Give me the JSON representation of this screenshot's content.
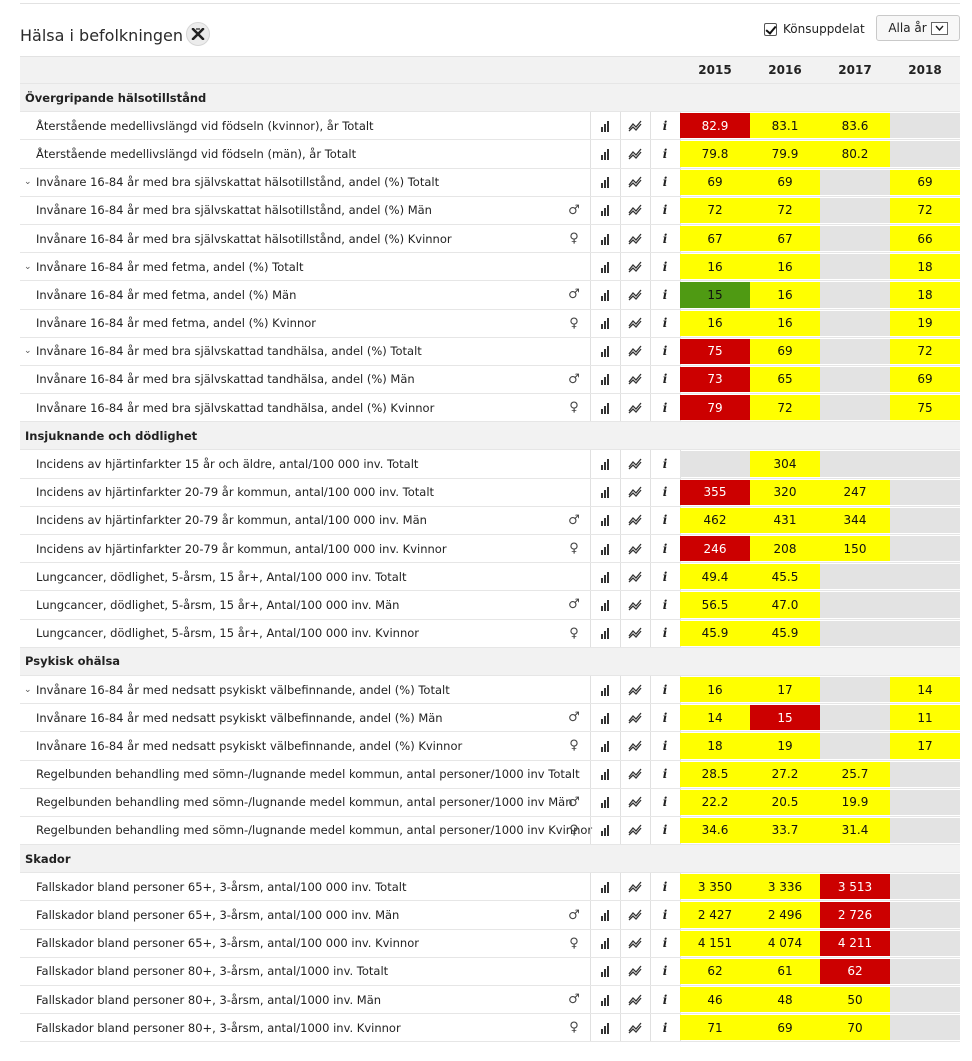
{
  "header": {
    "title": "Hälsa i befolkningen",
    "gender_split_label": "Könsuppdelat",
    "gender_split_checked": true,
    "year_select_label": "Alla år"
  },
  "years": [
    "2015",
    "2016",
    "2017",
    "2018"
  ],
  "colors": {
    "yellow": "#ffff00",
    "red": "#cc0000",
    "green": "#4f9a13",
    "gray": "#e3e3e3"
  },
  "icons": {
    "excel": "excel-icon",
    "bar": "bar-chart-icon",
    "trend": "trend-icon",
    "info": "info-icon",
    "male": "male-icon",
    "female": "female-icon"
  },
  "sections": [
    {
      "title": "Övergripande hälsotillstånd",
      "rows": [
        {
          "label": "Återstående medellivslängd vid födseln (kvinnor), år Totalt",
          "expandable": false,
          "gender": "",
          "cells": [
            {
              "v": "82.9",
              "c": "red"
            },
            {
              "v": "83.1",
              "c": "yellow"
            },
            {
              "v": "83.6",
              "c": "yellow"
            },
            {
              "v": "",
              "c": "gray"
            }
          ]
        },
        {
          "label": "Återstående medellivslängd vid födseln (män), år Totalt",
          "expandable": false,
          "gender": "",
          "cells": [
            {
              "v": "79.8",
              "c": "yellow"
            },
            {
              "v": "79.9",
              "c": "yellow"
            },
            {
              "v": "80.2",
              "c": "yellow"
            },
            {
              "v": "",
              "c": "gray"
            }
          ]
        },
        {
          "label": "Invånare 16-84 år med bra självskattat hälsotillstånd, andel (%) Totalt",
          "expandable": true,
          "gender": "",
          "cells": [
            {
              "v": "69",
              "c": "yellow"
            },
            {
              "v": "69",
              "c": "yellow"
            },
            {
              "v": "",
              "c": "gray"
            },
            {
              "v": "69",
              "c": "yellow"
            }
          ]
        },
        {
          "label": "Invånare 16-84 år med bra självskattat hälsotillstånd, andel (%) Män",
          "expandable": false,
          "gender": "male",
          "cells": [
            {
              "v": "72",
              "c": "yellow"
            },
            {
              "v": "72",
              "c": "yellow"
            },
            {
              "v": "",
              "c": "gray"
            },
            {
              "v": "72",
              "c": "yellow"
            }
          ]
        },
        {
          "label": "Invånare 16-84 år med bra självskattat hälsotillstånd, andel (%) Kvinnor",
          "expandable": false,
          "gender": "female",
          "cells": [
            {
              "v": "67",
              "c": "yellow"
            },
            {
              "v": "67",
              "c": "yellow"
            },
            {
              "v": "",
              "c": "gray"
            },
            {
              "v": "66",
              "c": "yellow"
            }
          ]
        },
        {
          "label": "Invånare 16-84 år med fetma, andel (%) Totalt",
          "expandable": true,
          "gender": "",
          "cells": [
            {
              "v": "16",
              "c": "yellow"
            },
            {
              "v": "16",
              "c": "yellow"
            },
            {
              "v": "",
              "c": "gray"
            },
            {
              "v": "18",
              "c": "yellow"
            }
          ]
        },
        {
          "label": "Invånare 16-84 år med fetma, andel (%) Män",
          "expandable": false,
          "gender": "male",
          "cells": [
            {
              "v": "15",
              "c": "green"
            },
            {
              "v": "16",
              "c": "yellow"
            },
            {
              "v": "",
              "c": "gray"
            },
            {
              "v": "18",
              "c": "yellow"
            }
          ]
        },
        {
          "label": "Invånare 16-84 år med fetma, andel (%) Kvinnor",
          "expandable": false,
          "gender": "female",
          "cells": [
            {
              "v": "16",
              "c": "yellow"
            },
            {
              "v": "16",
              "c": "yellow"
            },
            {
              "v": "",
              "c": "gray"
            },
            {
              "v": "19",
              "c": "yellow"
            }
          ]
        },
        {
          "label": "Invånare 16-84 år med bra självskattad tandhälsa, andel (%) Totalt",
          "expandable": true,
          "gender": "",
          "cells": [
            {
              "v": "75",
              "c": "red"
            },
            {
              "v": "69",
              "c": "yellow"
            },
            {
              "v": "",
              "c": "gray"
            },
            {
              "v": "72",
              "c": "yellow"
            }
          ]
        },
        {
          "label": "Invånare 16-84 år med bra självskattad tandhälsa, andel (%) Män",
          "expandable": false,
          "gender": "male",
          "cells": [
            {
              "v": "73",
              "c": "red"
            },
            {
              "v": "65",
              "c": "yellow"
            },
            {
              "v": "",
              "c": "gray"
            },
            {
              "v": "69",
              "c": "yellow"
            }
          ]
        },
        {
          "label": "Invånare 16-84 år med bra självskattad tandhälsa, andel (%) Kvinnor",
          "expandable": false,
          "gender": "female",
          "cells": [
            {
              "v": "79",
              "c": "red"
            },
            {
              "v": "72",
              "c": "yellow"
            },
            {
              "v": "",
              "c": "gray"
            },
            {
              "v": "75",
              "c": "yellow"
            }
          ]
        }
      ]
    },
    {
      "title": "Insjuknande och dödlighet",
      "rows": [
        {
          "label": "Incidens av hjärtinfarkter 15 år och äldre, antal/100 000 inv. Totalt",
          "expandable": false,
          "gender": "",
          "cells": [
            {
              "v": "",
              "c": "gray"
            },
            {
              "v": "304",
              "c": "yellow"
            },
            {
              "v": "",
              "c": "gray"
            },
            {
              "v": "",
              "c": "gray"
            }
          ]
        },
        {
          "label": "Incidens av hjärtinfarkter 20-79 år kommun, antal/100 000 inv. Totalt",
          "expandable": false,
          "gender": "",
          "cells": [
            {
              "v": "355",
              "c": "red"
            },
            {
              "v": "320",
              "c": "yellow"
            },
            {
              "v": "247",
              "c": "yellow"
            },
            {
              "v": "",
              "c": "gray"
            }
          ]
        },
        {
          "label": "Incidens av hjärtinfarkter 20-79 år kommun, antal/100 000 inv. Män",
          "expandable": false,
          "gender": "male",
          "cells": [
            {
              "v": "462",
              "c": "yellow"
            },
            {
              "v": "431",
              "c": "yellow"
            },
            {
              "v": "344",
              "c": "yellow"
            },
            {
              "v": "",
              "c": "gray"
            }
          ]
        },
        {
          "label": "Incidens av hjärtinfarkter 20-79 år kommun, antal/100 000 inv. Kvinnor",
          "expandable": false,
          "gender": "female",
          "cells": [
            {
              "v": "246",
              "c": "red"
            },
            {
              "v": "208",
              "c": "yellow"
            },
            {
              "v": "150",
              "c": "yellow"
            },
            {
              "v": "",
              "c": "gray"
            }
          ]
        },
        {
          "label": "Lungcancer, dödlighet, 5-årsm, 15 år+, Antal/100 000 inv. Totalt",
          "expandable": false,
          "gender": "",
          "cells": [
            {
              "v": "49.4",
              "c": "yellow"
            },
            {
              "v": "45.5",
              "c": "yellow"
            },
            {
              "v": "",
              "c": "gray"
            },
            {
              "v": "",
              "c": "gray"
            }
          ]
        },
        {
          "label": "Lungcancer, dödlighet, 5-årsm, 15 år+, Antal/100 000 inv. Män",
          "expandable": false,
          "gender": "male",
          "cells": [
            {
              "v": "56.5",
              "c": "yellow"
            },
            {
              "v": "47.0",
              "c": "yellow"
            },
            {
              "v": "",
              "c": "gray"
            },
            {
              "v": "",
              "c": "gray"
            }
          ]
        },
        {
          "label": "Lungcancer, dödlighet, 5-årsm, 15 år+, Antal/100 000 inv. Kvinnor",
          "expandable": false,
          "gender": "female",
          "cells": [
            {
              "v": "45.9",
              "c": "yellow"
            },
            {
              "v": "45.9",
              "c": "yellow"
            },
            {
              "v": "",
              "c": "gray"
            },
            {
              "v": "",
              "c": "gray"
            }
          ]
        }
      ]
    },
    {
      "title": "Psykisk ohälsa",
      "rows": [
        {
          "label": "Invånare 16-84 år med nedsatt psykiskt välbefinnande, andel (%) Totalt",
          "expandable": true,
          "gender": "",
          "cells": [
            {
              "v": "16",
              "c": "yellow"
            },
            {
              "v": "17",
              "c": "yellow"
            },
            {
              "v": "",
              "c": "gray"
            },
            {
              "v": "14",
              "c": "yellow"
            }
          ]
        },
        {
          "label": "Invånare 16-84 år med nedsatt psykiskt välbefinnande, andel (%) Män",
          "expandable": false,
          "gender": "male",
          "cells": [
            {
              "v": "14",
              "c": "yellow"
            },
            {
              "v": "15",
              "c": "red"
            },
            {
              "v": "",
              "c": "gray"
            },
            {
              "v": "11",
              "c": "yellow"
            }
          ]
        },
        {
          "label": "Invånare 16-84 år med nedsatt psykiskt välbefinnande, andel (%) Kvinnor",
          "expandable": false,
          "gender": "female",
          "cells": [
            {
              "v": "18",
              "c": "yellow"
            },
            {
              "v": "19",
              "c": "yellow"
            },
            {
              "v": "",
              "c": "gray"
            },
            {
              "v": "17",
              "c": "yellow"
            }
          ]
        },
        {
          "label": "Regelbunden behandling med sömn-/lugnande medel kommun, antal personer/1000 inv Totalt",
          "expandable": false,
          "gender": "",
          "cells": [
            {
              "v": "28.5",
              "c": "yellow"
            },
            {
              "v": "27.2",
              "c": "yellow"
            },
            {
              "v": "25.7",
              "c": "yellow"
            },
            {
              "v": "",
              "c": "gray"
            }
          ]
        },
        {
          "label": "Regelbunden behandling med sömn-/lugnande medel kommun, antal personer/1000 inv Män",
          "expandable": false,
          "gender": "male",
          "cells": [
            {
              "v": "22.2",
              "c": "yellow"
            },
            {
              "v": "20.5",
              "c": "yellow"
            },
            {
              "v": "19.9",
              "c": "yellow"
            },
            {
              "v": "",
              "c": "gray"
            }
          ]
        },
        {
          "label": "Regelbunden behandling med sömn-/lugnande medel kommun, antal personer/1000 inv Kvinnor",
          "expandable": false,
          "gender": "female",
          "cells": [
            {
              "v": "34.6",
              "c": "yellow"
            },
            {
              "v": "33.7",
              "c": "yellow"
            },
            {
              "v": "31.4",
              "c": "yellow"
            },
            {
              "v": "",
              "c": "gray"
            }
          ]
        }
      ]
    },
    {
      "title": "Skador",
      "rows": [
        {
          "label": "Fallskador bland personer 65+, 3-årsm, antal/100 000 inv. Totalt",
          "expandable": false,
          "gender": "",
          "cells": [
            {
              "v": "3 350",
              "c": "yellow"
            },
            {
              "v": "3 336",
              "c": "yellow"
            },
            {
              "v": "3 513",
              "c": "red"
            },
            {
              "v": "",
              "c": "gray"
            }
          ]
        },
        {
          "label": "Fallskador bland personer 65+, 3-årsm, antal/100 000 inv. Män",
          "expandable": false,
          "gender": "male",
          "cells": [
            {
              "v": "2 427",
              "c": "yellow"
            },
            {
              "v": "2 496",
              "c": "yellow"
            },
            {
              "v": "2 726",
              "c": "red"
            },
            {
              "v": "",
              "c": "gray"
            }
          ]
        },
        {
          "label": "Fallskador bland personer 65+, 3-årsm, antal/100 000 inv. Kvinnor",
          "expandable": false,
          "gender": "female",
          "cells": [
            {
              "v": "4 151",
              "c": "yellow"
            },
            {
              "v": "4 074",
              "c": "yellow"
            },
            {
              "v": "4 211",
              "c": "red"
            },
            {
              "v": "",
              "c": "gray"
            }
          ]
        },
        {
          "label": "Fallskador bland personer 80+, 3-årsm, antal/1000 inv. Totalt",
          "expandable": false,
          "gender": "",
          "cells": [
            {
              "v": "62",
              "c": "yellow"
            },
            {
              "v": "61",
              "c": "yellow"
            },
            {
              "v": "62",
              "c": "red"
            },
            {
              "v": "",
              "c": "gray"
            }
          ]
        },
        {
          "label": "Fallskador bland personer 80+, 3-årsm, antal/1000 inv. Män",
          "expandable": false,
          "gender": "male",
          "cells": [
            {
              "v": "46",
              "c": "yellow"
            },
            {
              "v": "48",
              "c": "yellow"
            },
            {
              "v": "50",
              "c": "yellow"
            },
            {
              "v": "",
              "c": "gray"
            }
          ]
        },
        {
          "label": "Fallskador bland personer 80+, 3-årsm, antal/1000 inv. Kvinnor",
          "expandable": false,
          "gender": "female",
          "cells": [
            {
              "v": "71",
              "c": "yellow"
            },
            {
              "v": "69",
              "c": "yellow"
            },
            {
              "v": "70",
              "c": "yellow"
            },
            {
              "v": "",
              "c": "gray"
            }
          ]
        }
      ]
    }
  ]
}
